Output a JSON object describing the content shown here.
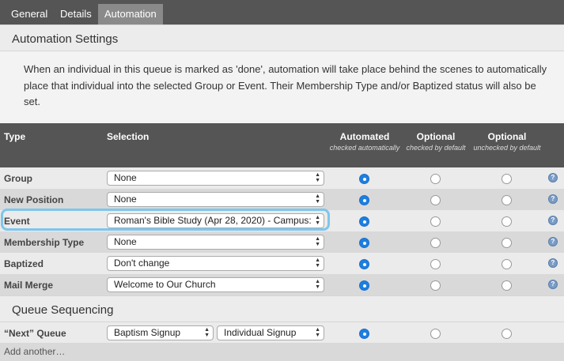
{
  "tabs": [
    {
      "label": "General"
    },
    {
      "label": "Details"
    },
    {
      "label": "Automation"
    }
  ],
  "automation_settings": {
    "title": "Automation Settings",
    "description": "When an individual in this queue is marked as 'done', automation will take place behind the scenes to automatically place that individual into the selected Group or Event. Their Membership Type and/or Baptized status will also be set."
  },
  "table": {
    "headers": {
      "type": "Type",
      "selection": "Selection",
      "automated": "Automated",
      "automated_sub": "checked automatically",
      "optional_checked": "Optional",
      "optional_checked_sub": "checked by default",
      "optional_unchecked": "Optional",
      "optional_unchecked_sub": "unchecked by default"
    },
    "rows": [
      {
        "label": "Group",
        "selection": "None"
      },
      {
        "label": "New Position",
        "selection": "None"
      },
      {
        "label": "Event",
        "selection": "Roman's Bible Study (Apr 28, 2020) - Campus:"
      },
      {
        "label": "Membership Type",
        "selection": "None"
      },
      {
        "label": "Baptized",
        "selection": "Don't change"
      },
      {
        "label": "Mail Merge",
        "selection": "Welcome to Our Church"
      }
    ]
  },
  "queue_sequencing": {
    "title": "Queue Sequencing",
    "row_label": "“Next” Queue",
    "select_1": "Baptism Signup",
    "select_2": "Individual Signup",
    "add_another": "Add another…"
  },
  "icons": {
    "help": "question-icon",
    "select_arrows": "updown-arrows-icon"
  },
  "colors": {
    "tab_bar": "#555555",
    "active_tab": "#8a8a8a",
    "radio_selected": "#1c7fe0",
    "highlight": "#7ec6ec"
  }
}
